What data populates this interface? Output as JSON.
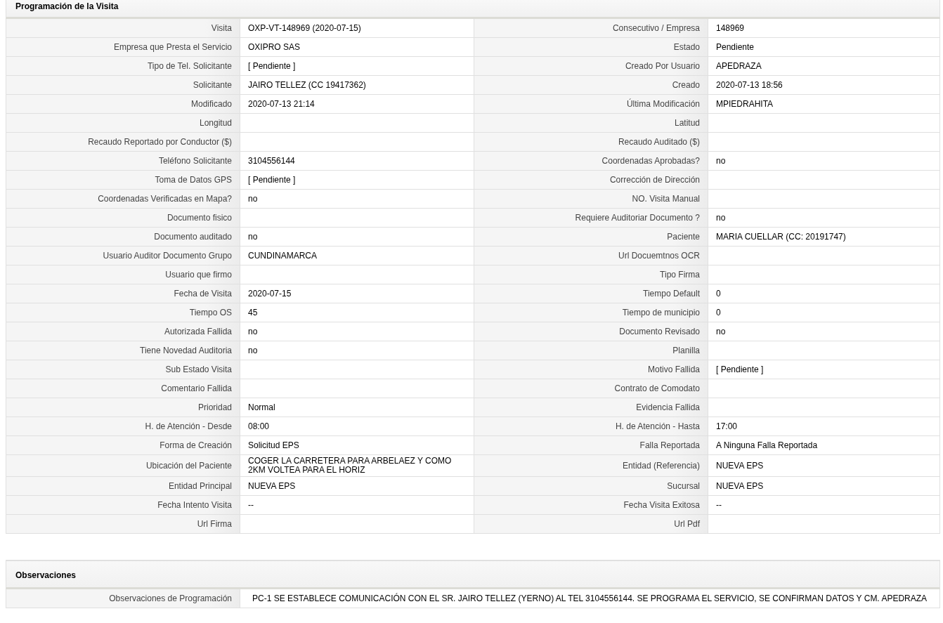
{
  "section": {
    "title": "Programación de la Visita",
    "rows": [
      {
        "left": {
          "label": "Visita",
          "value": "OXP-VT-148969 (2020-07-15)"
        },
        "right": {
          "label": "Consecutivo / Empresa",
          "value": "148969"
        }
      },
      {
        "left": {
          "label": "Empresa que Presta el Servicio",
          "value": "OXIPRO SAS"
        },
        "right": {
          "label": "Estado",
          "value": "Pendiente"
        }
      },
      {
        "left": {
          "label": "Tipo de Tel. Solicitante",
          "value": "[ Pendiente ]"
        },
        "right": {
          "label": "Creado Por Usuario",
          "value": "APEDRAZA"
        }
      },
      {
        "left": {
          "label": "Solicitante",
          "value": "JAIRO TELLEZ (CC 19417362)"
        },
        "right": {
          "label": "Creado",
          "value": "2020-07-13 18:56"
        }
      },
      {
        "left": {
          "label": "Modificado",
          "value": "2020-07-13 21:14"
        },
        "right": {
          "label": "Última Modificación",
          "value": "MPIEDRAHITA"
        }
      },
      {
        "left": {
          "label": "Longitud"
        },
        "right": {
          "label": "Latitud"
        }
      },
      {
        "left": {
          "label": "Recaudo Reportado por Conductor ($)"
        },
        "right": {
          "label": "Recaudo Auditado ($)"
        }
      },
      {
        "left": {
          "label": "Teléfono Solicitante",
          "value": "3104556144"
        },
        "right": {
          "label": "Coordenadas Aprobadas?",
          "value": "no"
        }
      },
      {
        "left": {
          "label": "Toma de Datos GPS",
          "value": "[ Pendiente ]"
        },
        "right": {
          "label": "Corrección de Dirección"
        }
      },
      {
        "left": {
          "label": "Coordenadas Verificadas en Mapa?",
          "value": "no"
        },
        "right": {
          "label": "NO. Visita Manual"
        }
      },
      {
        "left": {
          "label": "Documento fisico"
        },
        "right": {
          "label": "Requiere Auditoriar Documento ?",
          "value": "no"
        }
      },
      {
        "left": {
          "label": "Documento auditado",
          "value": "no"
        },
        "right": {
          "label": "Paciente",
          "value": "MARIA CUELLAR (CC: 20191747)"
        }
      },
      {
        "left": {
          "label": "Usuario Auditor Documento Grupo",
          "value": "CUNDINAMARCA"
        },
        "right": {
          "label": "Url Docuemtnos OCR"
        }
      },
      {
        "left": {
          "label": "Usuario que firmo"
        },
        "right": {
          "label": "Tipo Firma"
        }
      },
      {
        "left": {
          "label": "Fecha de Visita",
          "value": "2020-07-15"
        },
        "right": {
          "label": "Tiempo Default",
          "value": "0"
        }
      },
      {
        "left": {
          "label": "Tiempo OS",
          "value": "45"
        },
        "right": {
          "label": "Tiempo de municipio",
          "value": "0"
        }
      },
      {
        "left": {
          "label": "Autorizada Fallida",
          "value": "no"
        },
        "right": {
          "label": "Documento Revisado",
          "value": "no"
        }
      },
      {
        "left": {
          "label": "Tiene Novedad Auditoria",
          "value": "no"
        },
        "right": {
          "label": "Planilla"
        }
      },
      {
        "left": {
          "label": "Sub Estado Visita"
        },
        "right": {
          "label": "Motivo Fallida",
          "value": "[ Pendiente ]"
        }
      },
      {
        "left": {
          "label": "Comentario Fallida"
        },
        "right": {
          "label": "Contrato de Comodato"
        }
      },
      {
        "left": {
          "label": "Prioridad",
          "value": "Normal"
        },
        "right": {
          "label": "Evidencia Fallida"
        }
      },
      {
        "left": {
          "label": "H. de Atención - Desde",
          "value": "08:00"
        },
        "right": {
          "label": "H. de Atención - Hasta",
          "value": "17:00"
        }
      },
      {
        "left": {
          "label": "Forma de Creación",
          "value": "Solicitud EPS"
        },
        "right": {
          "label": "Falla Reportada",
          "value": "A Ninguna Falla Reportada"
        }
      },
      {
        "left": {
          "label": "Ubicación del Paciente",
          "value": "COGER LA CARRETERA PARA ARBELAEZ Y COMO 2KM VOLTEA PARA EL HORIZ"
        },
        "right": {
          "label": "Entidad (Referencia)",
          "value": "NUEVA EPS"
        }
      },
      {
        "left": {
          "label": "Entidad Principal",
          "value": "NUEVA EPS"
        },
        "right": {
          "label": "Sucursal",
          "value": "NUEVA EPS"
        }
      },
      {
        "left": {
          "label": "Fecha Intento Visita",
          "value": "--"
        },
        "right": {
          "label": "Fecha Visita Exitosa",
          "value": "--"
        }
      },
      {
        "left": {
          "label": "Url Firma"
        },
        "right": {
          "label": "Url Pdf"
        }
      }
    ]
  },
  "observations": {
    "title": "Observaciones",
    "rows": [
      {
        "label": "Observaciones de Programación",
        "value": "PC-1 SE ESTABLECE COMUNICACIÓN CON EL SR. JAIRO TELLEZ (YERNO) AL TEL 3104556144. SE PROGRAMA EL SERVICIO, SE CONFIRMAN DATOS Y CM. APEDRAZA"
      }
    ]
  }
}
